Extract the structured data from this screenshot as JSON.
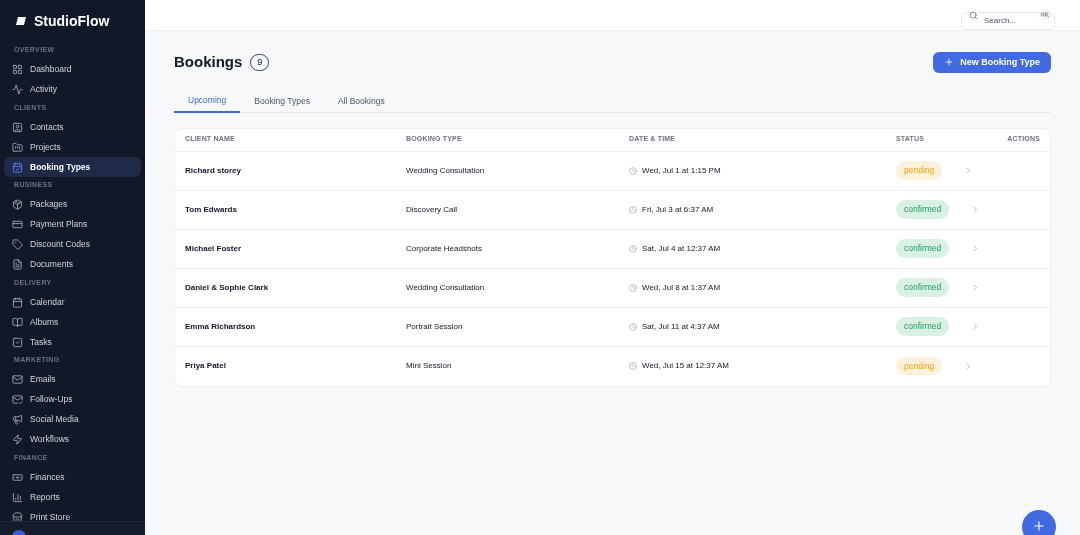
{
  "brand": "StudioFlow",
  "sidebar": {
    "sections": [
      {
        "heading": "OVERVIEW",
        "items": [
          {
            "label": "Dashboard",
            "kind": "grid",
            "selected": false
          },
          {
            "label": "Activity",
            "kind": "activity",
            "selected": false
          }
        ]
      },
      {
        "heading": "CLIENTS",
        "items": [
          {
            "label": "Contacts",
            "kind": "contact",
            "selected": false
          },
          {
            "label": "Projects",
            "kind": "folder",
            "selected": false
          },
          {
            "label": "Booking Types",
            "kind": "calcheck",
            "selected": true
          }
        ]
      },
      {
        "heading": "BUSINESS",
        "items": [
          {
            "label": "Packages",
            "kind": "package",
            "selected": false
          },
          {
            "label": "Payment Plans",
            "kind": "card",
            "selected": false
          },
          {
            "label": "Discount Codes",
            "kind": "tag",
            "selected": false
          },
          {
            "label": "Documents",
            "kind": "file",
            "selected": false
          }
        ]
      },
      {
        "heading": "DELIVERY",
        "items": [
          {
            "label": "Calendar",
            "kind": "calendar",
            "selected": false
          },
          {
            "label": "Albums",
            "kind": "book",
            "selected": false
          },
          {
            "label": "Tasks",
            "kind": "task",
            "selected": false
          }
        ]
      },
      {
        "heading": "MARKETING",
        "items": [
          {
            "label": "Emails",
            "kind": "mail",
            "selected": false
          },
          {
            "label": "Follow-Ups",
            "kind": "mailcheck",
            "selected": false
          },
          {
            "label": "Social Media",
            "kind": "megaphone",
            "selected": false
          },
          {
            "label": "Workflows",
            "kind": "zap",
            "selected": false
          }
        ]
      },
      {
        "heading": "FINANCE",
        "items": [
          {
            "label": "Finances",
            "kind": "money",
            "selected": false
          },
          {
            "label": "Reports",
            "kind": "chart",
            "selected": false
          },
          {
            "label": "Print Store",
            "kind": "store",
            "selected": false
          }
        ]
      }
    ]
  },
  "search": {
    "placeholder": "Search...",
    "shortcut": "⌘K"
  },
  "page": {
    "title": "Bookings",
    "count": "9",
    "new_button": "New Booking Type"
  },
  "tabs": [
    {
      "label": "Upcoming",
      "selected": true
    },
    {
      "label": "Booking Types",
      "selected": false
    },
    {
      "label": "All Bookings",
      "selected": false
    }
  ],
  "table": {
    "columns": [
      "CLIENT NAME",
      "BOOKING TYPE",
      "DATE & TIME",
      "STATUS",
      "ACTIONS"
    ],
    "rows": [
      {
        "client": "Richard storey",
        "type": "Wedding Consultation",
        "datetime": "Wed, Jul 1 at 1:15 PM",
        "status": "pending",
        "kind": "pending"
      },
      {
        "client": "Tom Edwards",
        "type": "Discovery Call",
        "datetime": "Fri, Jul 3 at 6:37 AM",
        "status": "confirmed",
        "kind": "confirmed"
      },
      {
        "client": "Michael Foster",
        "type": "Corporate Headshots",
        "datetime": "Sat, Jul 4 at 12:37 AM",
        "status": "confirmed",
        "kind": "confirmed"
      },
      {
        "client": "Daniel & Sophie Clark",
        "type": "Wedding Consultation",
        "datetime": "Wed, Jul 8 at 1:37 AM",
        "status": "confirmed",
        "kind": "confirmed"
      },
      {
        "client": "Emma Richardson",
        "type": "Portrait Session",
        "datetime": "Sat, Jul 11 at 4:37 AM",
        "status": "confirmed",
        "kind": "confirmed"
      },
      {
        "client": "Priya Patel",
        "type": "Mini Session",
        "datetime": "Wed, Jul 15 at 12:37 AM",
        "status": "pending",
        "kind": "pending"
      }
    ]
  }
}
